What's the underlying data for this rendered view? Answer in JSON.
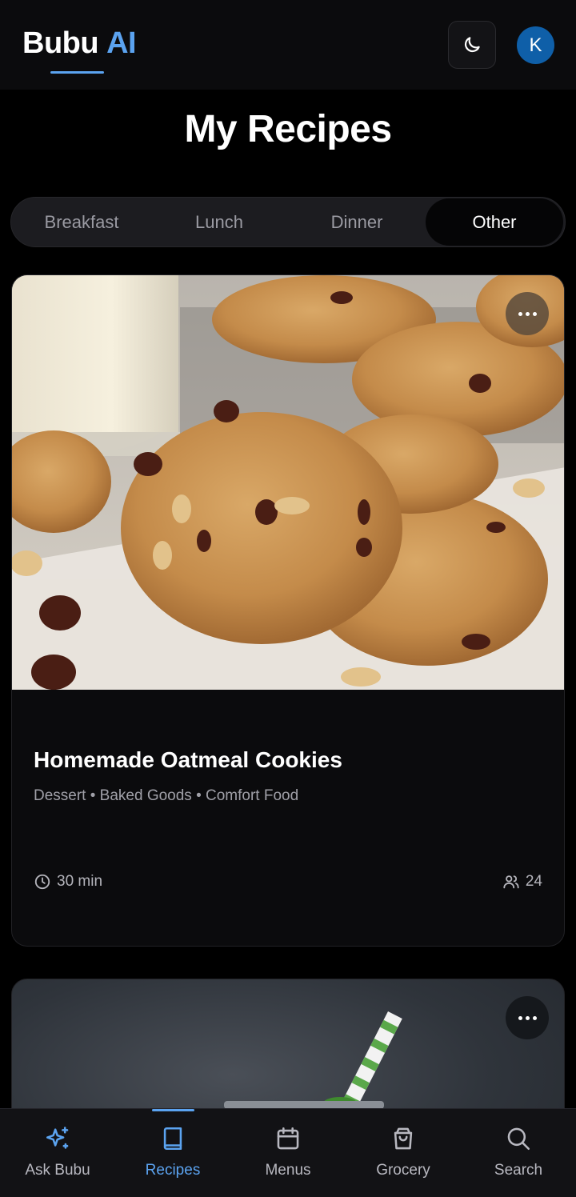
{
  "header": {
    "brand_name": "Bubu",
    "brand_ai": "AI",
    "theme_icon": "moon-icon",
    "avatar_initial": "K",
    "accent_color": "#5ba3f0",
    "avatar_color": "#0f5fa8"
  },
  "page": {
    "title": "My Recipes"
  },
  "tabs": {
    "items": [
      "Breakfast",
      "Lunch",
      "Dinner",
      "Other"
    ],
    "active": "Other"
  },
  "recipes": [
    {
      "title": "Homemade Oatmeal Cookies",
      "tags": "Dessert • Baked Goods • Comfort Food",
      "time": "30 min",
      "servings": "24",
      "image_icon": "oatmeal-cookies-photo"
    },
    {
      "image_icon": "green-smoothie-photo"
    }
  ],
  "bottom_nav": {
    "items": [
      {
        "label": "Ask Bubu",
        "icon": "sparkle-icon"
      },
      {
        "label": "Recipes",
        "icon": "book-icon"
      },
      {
        "label": "Menus",
        "icon": "calendar-icon"
      },
      {
        "label": "Grocery",
        "icon": "shopping-bag-icon"
      },
      {
        "label": "Search",
        "icon": "search-icon"
      }
    ],
    "active": "Recipes"
  }
}
